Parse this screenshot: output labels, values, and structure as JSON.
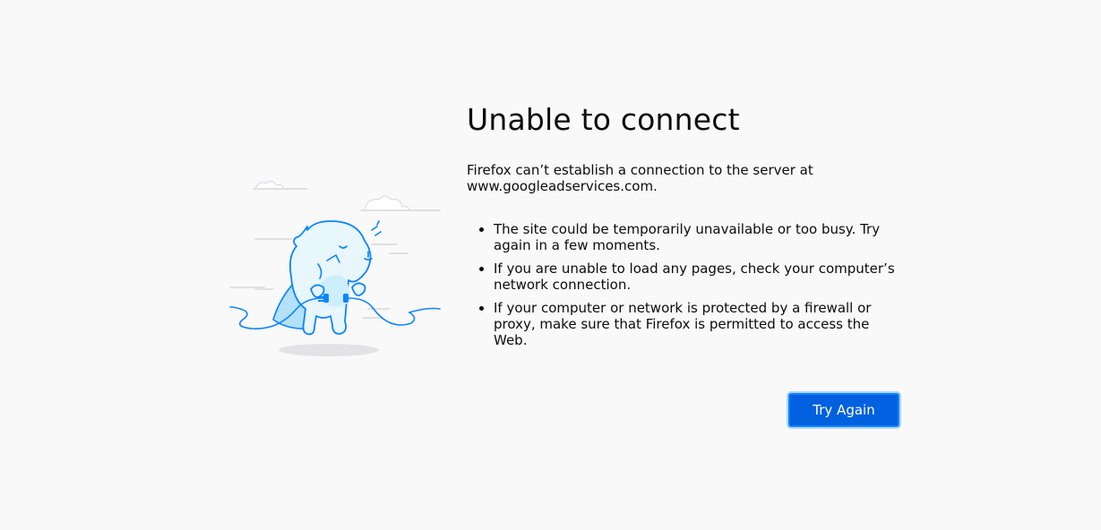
{
  "error": {
    "title": "Unable to connect",
    "description_prefix": "Firefox can’t establish a connection to the server at",
    "host": "www.googleadservices.com.",
    "tips": [
      "The site could be temporarily unavailable or too busy. Try again in a few moments.",
      "If you are unable to load any pages, check your computer’s network connection.",
      "If your computer or network is protected by a firewall or proxy, make sure that Firefox is permitted to access the Web."
    ]
  },
  "actions": {
    "try_again_label": "Try Again"
  },
  "colors": {
    "background": "#f9f9fa",
    "accent": "#0060df",
    "illustration": "#0a84ff"
  },
  "icons": {
    "illustration": "unplugged-dinosaur-illustration"
  }
}
